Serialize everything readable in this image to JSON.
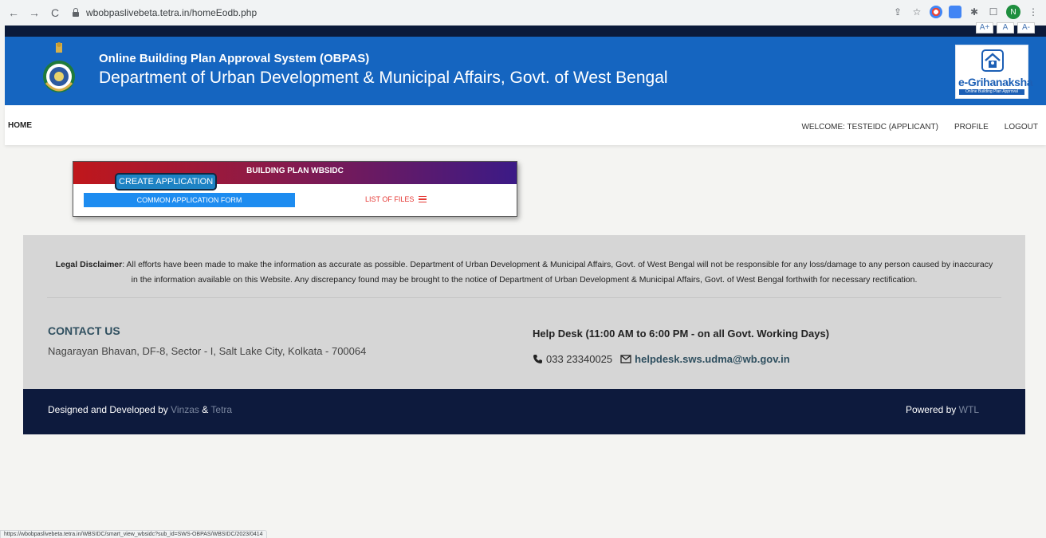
{
  "browser": {
    "url": "wbobpaslivebeta.tetra.in/homeEodb.php",
    "back_icon": "←",
    "forward_icon": "→",
    "reload_icon": "C",
    "share_icon": "⇪",
    "star_icon": "☆",
    "puzzle_icon": "✱",
    "window_icon": "☐",
    "menu_icon": "⋮",
    "avatar_initial": "N"
  },
  "font_size_buttons": [
    "A+",
    "A",
    "A-"
  ],
  "header": {
    "subtitle": "Online Building Plan Approval System (OBPAS)",
    "title": "Department of Urban Development & Municipal Affairs, Govt. of West Bengal",
    "logo_text_e": "e-",
    "logo_text_main": "Grihanaksha",
    "logo_tagline": "Online Building Plan Approval System",
    "bg_color": "#1565c0"
  },
  "nav": {
    "home": "HOME",
    "welcome": "WELCOME: TESTEIDC (APPLICANT)",
    "profile": "PROFILE",
    "logout": "LOGOUT"
  },
  "card": {
    "title": "BUILDING PLAN WBSIDC",
    "create_tab": "CREATE APPLICATION",
    "common_form": "COMMON APPLICATION FORM",
    "list_files": "LIST OF FILES"
  },
  "disclaimer": {
    "label": "Legal Disclaimer",
    "text": ": All efforts have been made to make the information as accurate as possible. Department of Urban Development & Municipal Affairs, Govt. of West Bengal will not be responsible for any loss/damage to any person caused by inaccuracy in the information available on this Website. Any discrepancy found may be brought to the notice of Department of Urban Development & Municipal Affairs, Govt. of West Bengal forthwith for necessary rectification."
  },
  "contact": {
    "title": "CONTACT US",
    "address": "Nagarayan Bhavan, DF-8, Sector - I, Salt Lake City, Kolkata - 700064"
  },
  "helpdesk": {
    "title": "Help Desk (11:00 AM to 6:00 PM - on all Govt. Working Days)",
    "phone": "033 23340025",
    "email": "helpdesk.sws.udma@wb.gov.in"
  },
  "footer": {
    "designed_prefix": "Designed and Developed by",
    "vendor1": "Vinzas",
    "amp": "&",
    "vendor2": "Tetra",
    "powered_prefix": "Powered by",
    "powered_vendor": "WTL"
  },
  "status_bar": {
    "url": "https://wbobpaslivebeta.tetra.in/WBSIDC/smart_view_wbsidc?sub_id=SWS-OBPAS/WBSIDC/2023/0414"
  }
}
